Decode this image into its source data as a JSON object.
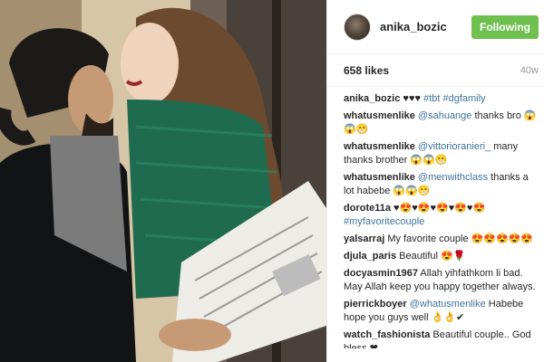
{
  "post": {
    "username": "anika_bozic",
    "follow_label": "Following",
    "likes": "658 likes",
    "age": "40w"
  },
  "comments": [
    {
      "user": "anika_bozic",
      "pre": " ♥♥♥ ",
      "mention": "",
      "text": "",
      "tags": "#tbt #dgfamily"
    },
    {
      "user": "whatusmenlike",
      "pre": " ",
      "mention": "@sahuange",
      "text": " thanks bro 😱😱😁",
      "tags": ""
    },
    {
      "user": "whatusmenlike",
      "pre": " ",
      "mention": "@vittorioranieri_",
      "text": " many thanks brother 😱😱😁",
      "tags": ""
    },
    {
      "user": "whatusmenlike",
      "pre": " ",
      "mention": "@menwithclass",
      "text": " thanks a lot habebe 😱😱😁",
      "tags": ""
    },
    {
      "user": "dorote11a",
      "pre": " ♥😍♥😍♥😍♥😍♥😍 ",
      "mention": "",
      "text": "",
      "tags": "#myfavoritecouple"
    },
    {
      "user": "yalsarraj",
      "pre": " ",
      "mention": "",
      "text": "My favorite couple 😍😍😍😍😍",
      "tags": ""
    },
    {
      "user": "djula_paris",
      "pre": " ",
      "mention": "",
      "text": "Beautiful 😍🌹",
      "tags": ""
    },
    {
      "user": "docyasmin1967",
      "pre": " ",
      "mention": "",
      "text": "Allah yihfathkom li bad. May Allah keep you happy together always.",
      "tags": ""
    },
    {
      "user": "pierrickboyer",
      "pre": " ",
      "mention": "@whatusmenlike",
      "text": " Habebe hope you guys well 👌👌✔",
      "tags": ""
    },
    {
      "user": "watch_fashionista",
      "pre": " ",
      "mention": "",
      "text": "Beautiful couple.. God bless ❤",
      "tags": ""
    }
  ]
}
